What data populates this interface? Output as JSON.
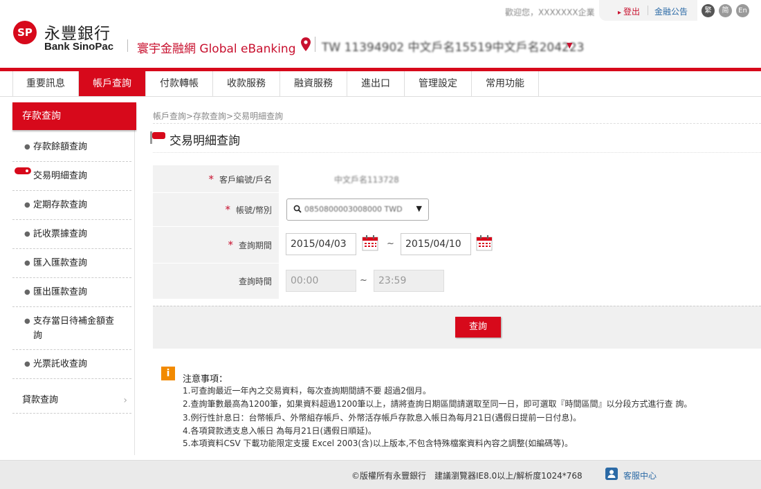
{
  "header": {
    "logo_mark": "SP",
    "bank_name_cn": "永豐銀行",
    "bank_name_en": "Bank SinoPac",
    "ebanking_title": "寰宇金融網 Global eBanking",
    "account_selector": "TW 11394902 中文戶名15519中文戶名204223",
    "greeting": "歡迎您，XXXXXXX企業",
    "logout": "登出",
    "bulletin": "金融公告",
    "lang_tc": "繁",
    "lang_sc": "简",
    "lang_en": "En"
  },
  "nav": {
    "items": [
      {
        "label": "重要訊息"
      },
      {
        "label": "帳戶查詢"
      },
      {
        "label": "付款轉帳"
      },
      {
        "label": "收款服務"
      },
      {
        "label": "融資服務"
      },
      {
        "label": "進出口"
      },
      {
        "label": "管理設定"
      },
      {
        "label": "常用功能"
      }
    ],
    "active_index": 1
  },
  "sidebar": {
    "header": "存款查詢",
    "items": [
      {
        "label": "存款餘額查詢"
      },
      {
        "label": "交易明細查詢"
      },
      {
        "label": "定期存款查詢"
      },
      {
        "label": "託收票據查詢"
      },
      {
        "label": "匯入匯款查詢"
      },
      {
        "label": "匯出匯款查詢"
      },
      {
        "label": "支存當日待補金額查詢"
      },
      {
        "label": "光票託收查詢"
      }
    ],
    "current_index": 1,
    "loan": "貸款查詢"
  },
  "main": {
    "breadcrumb": "帳戶查詢>存款查詢>交易明細查詢",
    "title": "交易明細查詢",
    "form": {
      "customer_label": "客戶編號/戶名",
      "customer_value": "中文戶名113728",
      "account_label": "帳號/幣別",
      "account_value": "0850800003008000 TWD",
      "period_label": "查詢期間",
      "date_from": "2015/04/03",
      "date_to": "2015/04/10",
      "time_label": "查詢時間",
      "time_from": "00:00",
      "time_to": "23:59",
      "range_sep": "~"
    },
    "query_button": "查詢"
  },
  "notice": {
    "icon": "i",
    "title": "注意事項：",
    "lines": [
      "1.可查詢最近一年內之交易資料，每次查詢期間請不要 超過2個月。",
      "2.查詢筆數最高為1200筆，如果資料超過1200筆以上，請將查詢日期區間請選取至同一日，即可選取『時間區間』以分段方式進行查 詢。",
      "3.例行性計息日：台幣帳戶、外幣組存帳戶、外幣活存帳戶存款息入帳日為每月21日(遇假日提前一日付息)。",
      "4.各項貸款透支息入帳日 為每月21日(遇假日順延)。",
      "5.本項資料CSV 下載功能限定支援 Excel 2003(含)以上版本,不包含特殊檔案資料內容之調整(如編碼等)。"
    ]
  },
  "footer": {
    "copyright": "©版權所有永豐銀行　建議瀏覽器IE8.0以上/解析度1024*768",
    "support": "客服中心"
  },
  "colors": {
    "brand_red": "#d7091b",
    "link_blue": "#2b6aa6",
    "notice_orange": "#f28a00"
  },
  "icons": [
    "location-pin-icon",
    "magnifier-icon",
    "calendar-icon",
    "info-icon",
    "flag-icon",
    "user-icon",
    "chevron-right-icon",
    "dropdown-caret-icon"
  ]
}
